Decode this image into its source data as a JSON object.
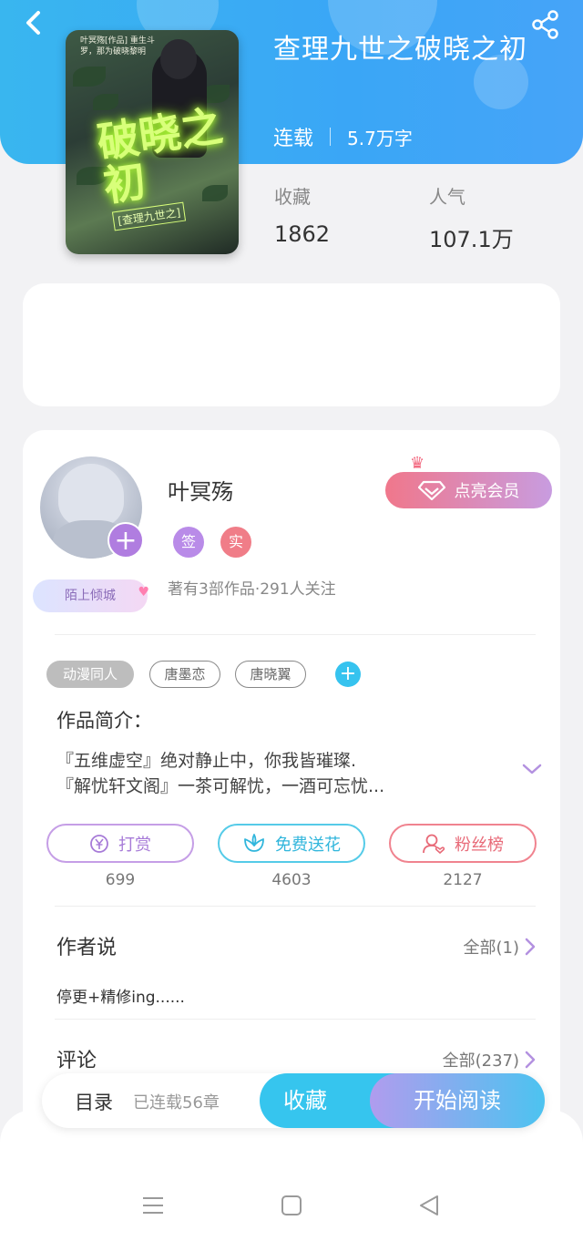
{
  "header": {
    "title": "查理九世之破晓之初",
    "status": "连载",
    "word_count": "5.7万字"
  },
  "cover": {
    "top_text": "叶冥殇[作品] 重生斗罗，那为破晓黎明",
    "title_art": "破晓之初",
    "subtitle_art": "[查理九世之]"
  },
  "stats": [
    {
      "label": "收藏",
      "value": "1862"
    },
    {
      "label": "人气",
      "value": "107.1万"
    }
  ],
  "author": {
    "name": "叶冥殇",
    "badges": [
      "签",
      "实"
    ],
    "meta": "著有3部作品·291人关注",
    "fan_tag": "陌上倾城",
    "vip_label": "点亮会员",
    "follow_symbol": "+"
  },
  "tags": [
    "动漫同人",
    "唐墨恋",
    "唐晓翼"
  ],
  "intro": {
    "title": "作品简介：",
    "lines": [
      "『五维虚空』绝对静止中，你我皆璀璨.",
      "『解忧轩文阁』一茶可解忧，一酒可忘忧..."
    ]
  },
  "actions": [
    {
      "label": "打赏",
      "count": "699",
      "icon": "yen-icon"
    },
    {
      "label": "免费送花",
      "count": "4603",
      "icon": "flower-icon"
    },
    {
      "label": "粉丝榜",
      "count": "2127",
      "icon": "fan-rank-icon"
    }
  ],
  "author_says": {
    "title": "作者说",
    "link": "全部(1)",
    "text": "停更+精修ing......"
  },
  "comments": {
    "title": "评论",
    "link": "全部(237)"
  },
  "bottom_bar": {
    "toc": "目录",
    "chapter_count": "已连载56章",
    "collect": "收藏",
    "read": "开始阅读"
  },
  "colors": {
    "header_blue": "#3aa6f6",
    "vip_pink": "#f0778b",
    "purple": "#b07de0",
    "cyan": "#36c5ee"
  }
}
